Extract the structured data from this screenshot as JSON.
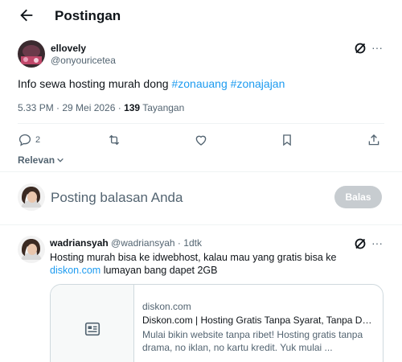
{
  "header": {
    "title": "Postingan"
  },
  "post": {
    "author_name": "ellovely",
    "author_handle": "@onyouricetea",
    "text_prefix": "Info sewa hosting murah dong ",
    "hashtags": [
      "#zonauang",
      "#zonajajan"
    ],
    "time": "5.33 PM · 29 Mei 2026 · ",
    "views_count": "139",
    "views_label": "Tayangan",
    "reply_count": "2"
  },
  "sort": {
    "label": "Relevan"
  },
  "composer": {
    "placeholder": "Posting balasan Anda",
    "button_label": "Balas"
  },
  "reply": {
    "author_name": "wadriansyah",
    "author_meta": "@wadriansyah · 1dtk",
    "text_line1": "Hosting murah bisa ke idwebhost, kalau mau yang gratis bisa ke",
    "link_text": "diskon.com",
    "text_line2_rest": " lumayan bang dapet 2GB",
    "card": {
      "domain": "diskon.com",
      "title": "Diskon.com | Hosting Gratis Tanpa Syarat, Tanpa Domain",
      "desc": "Mulai bikin website tanpa ribet! Hosting gratis tanpa drama, no iklan, no kartu kredit. Yuk mulai ..."
    }
  },
  "colors": {
    "accent": "#1d9bf0",
    "text": "#0f1419",
    "muted": "#536471",
    "button_disabled": "#c7ccd0"
  }
}
